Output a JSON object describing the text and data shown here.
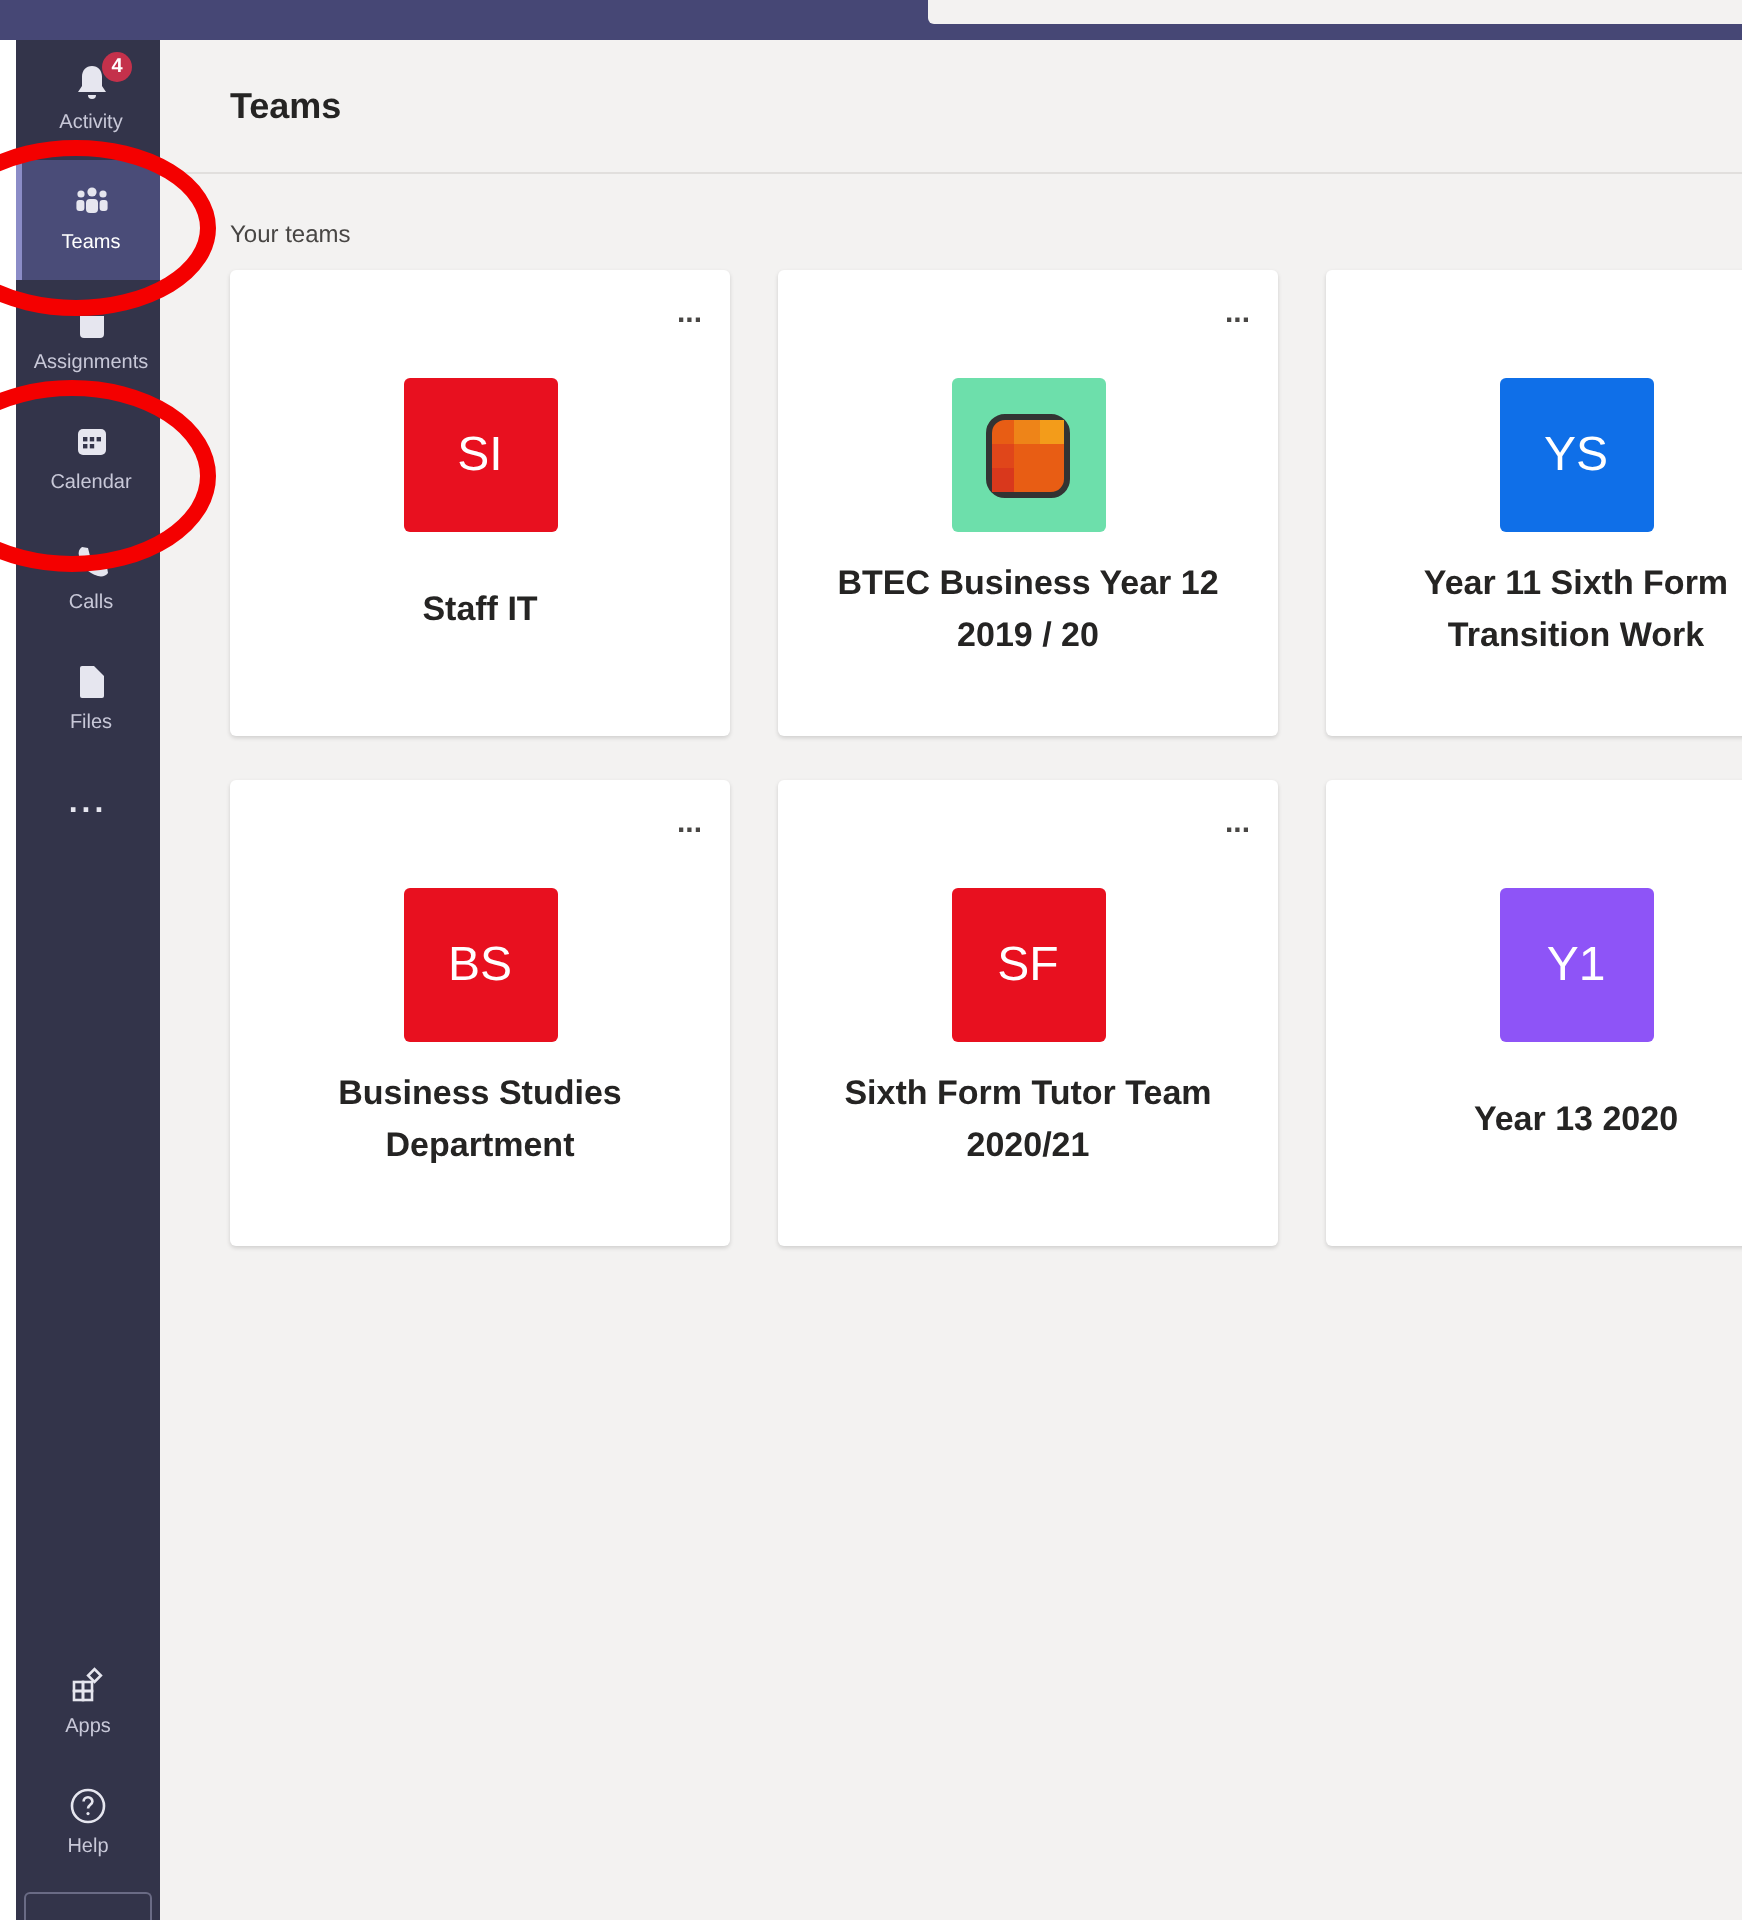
{
  "rail": {
    "items": [
      {
        "label": "Activity",
        "kind": "bell",
        "badge": "4",
        "selected": false
      },
      {
        "label": "Teams",
        "kind": "teams",
        "selected": true
      },
      {
        "label": "Assignments",
        "kind": "clipboard",
        "selected": false
      },
      {
        "label": "Calendar",
        "kind": "calendar",
        "selected": false
      },
      {
        "label": "Calls",
        "kind": "phone",
        "selected": false
      },
      {
        "label": "Files",
        "kind": "file",
        "selected": false
      }
    ],
    "more": "...",
    "bottom_items": [
      {
        "label": "Apps",
        "kind": "apps"
      },
      {
        "label": "Help",
        "kind": "help"
      }
    ]
  },
  "page": {
    "title": "Teams",
    "section": "Your teams"
  },
  "teams": [
    {
      "name": "Staff IT",
      "kind": "initials",
      "initials": "SI",
      "color": "#e8101f",
      "menu": "..."
    },
    {
      "name": "BTEC Business Year 12 2019 / 20",
      "kind": "icon",
      "color": "#6ddfab",
      "menu": "..."
    },
    {
      "name": "Year 11 Sixth Form Transition Work",
      "kind": "initials",
      "initials": "YS",
      "color": "#0f6fe8"
    },
    {
      "name": "Business Studies Department",
      "kind": "initials",
      "initials": "BS",
      "color": "#e8101f",
      "menu": "..."
    },
    {
      "name": "Sixth Form Tutor Team 2020/21",
      "kind": "initials",
      "initials": "SF",
      "color": "#e8101f",
      "menu": "..."
    },
    {
      "name": "Year 13 2020",
      "kind": "initials",
      "initials": "Y1",
      "color": "#8e54f7"
    }
  ]
}
